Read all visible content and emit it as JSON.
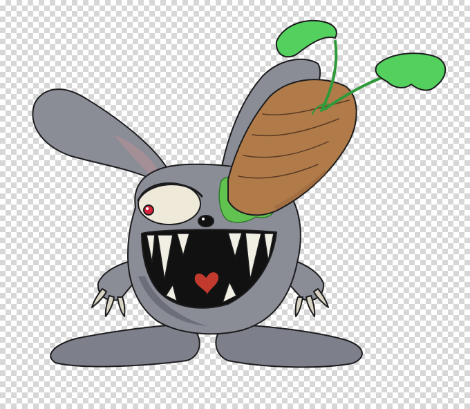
{
  "image": {
    "background": "transparency-checkerboard",
    "subject": "cartoon-monster-bunny",
    "colors": {
      "fur": "#8a8c96",
      "fur_dark": "#6c6e79",
      "fur_light": "#a7a9b2",
      "inner_ear": "#a58f97",
      "mouth": "#111111",
      "teeth": "#f1efe4",
      "tongue_heart": "#c23a2e",
      "eye_white": "#eee9d8",
      "pupil": "#d4233a",
      "carrot": "#b07a49",
      "carrot_dark": "#8b5a35",
      "leaves": "#53d05d",
      "leaves_dark": "#2f9a3a",
      "slime": "#62c24f",
      "claws": "#d9d4c4",
      "outline": "#1c1c1e"
    }
  }
}
